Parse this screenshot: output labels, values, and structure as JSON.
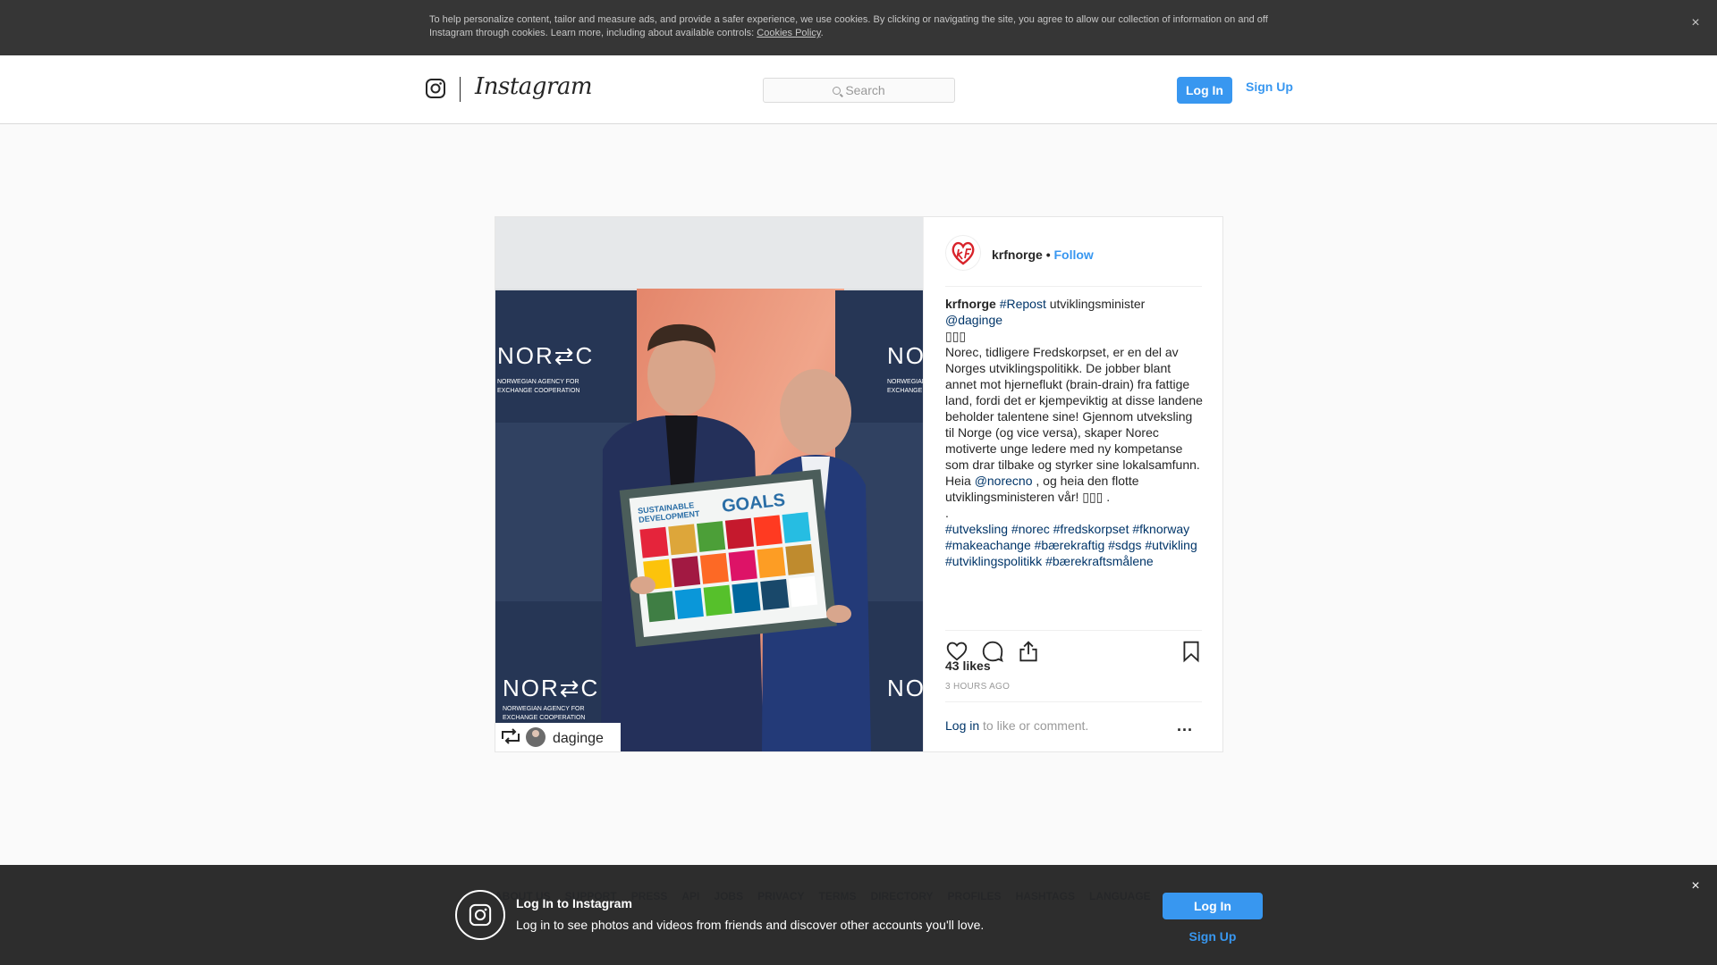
{
  "cookie_banner": {
    "text": "To help personalize content, tailor and measure ads, and provide a safer experience, we use cookies. By clicking or navigating the site, you agree to allow our collection of information on and off Instagram through cookies. Learn more, including about available controls: ",
    "link": "Cookies Policy",
    "close": "×"
  },
  "header": {
    "wordmark": "Instagram",
    "search_placeholder": "Search",
    "login": "Log In",
    "signup": "Sign Up"
  },
  "post": {
    "username": "krfnorge",
    "separator": "•",
    "follow": "Follow",
    "repost_user": "daginge",
    "caption": {
      "username": "krfnorge",
      "hashtag_repost": "#Repost",
      "text1": " utviklingsminister ",
      "mention1": "@daginge",
      "emoji1": "▯▯▯",
      "body": "Norec, tidligere Fredskorpset, er en del av Norges utviklingspolitikk. De jobber blant annet mot hjerneflukt (brain-drain) fra fattige land, fordi det er kjempeviktig at disse landene beholder talentene sine! Gjennom utveksling til Norge (og vice versa), skaper Norec motiverte unge ledere med ny kompetanse som drar tilbake og styrker sine lokalsamfunn. Heia ",
      "mention2": "@norecno",
      "body2": " , og heia den flotte utviklingsministeren vår! ▯▯▯  .",
      "dot": ".",
      "hashtags": [
        "#utveksling",
        "#norec",
        "#fredskorpset",
        "#fknorway",
        "#makeachange",
        "#bærekraftig",
        "#sdgs",
        "#utvikling",
        "#utviklingspolitikk",
        "#bærekraftsmålene"
      ]
    },
    "likes": "43 likes",
    "time": "3 HOURS AGO",
    "comment_login": "Log in",
    "comment_rest": " to like or comment.",
    "more": "..."
  },
  "photo_text": {
    "norec": "NOR⇄C",
    "agency_line1": "NORWEGIAN AGENCY FOR",
    "agency_line2": "EXCHANGE COOPERATION",
    "sdg_line1": "SUSTAINABLE",
    "sdg_line2": "DEVELOPMENT",
    "sdg_goals": "GOALS"
  },
  "footer_links": [
    "ABOUT US",
    "SUPPORT",
    "PRESS",
    "API",
    "JOBS",
    "PRIVACY",
    "TERMS",
    "DIRECTORY",
    "PROFILES",
    "HASHTAGS",
    "LANGUAGE"
  ],
  "bottom_bar": {
    "title": "Log In to Instagram",
    "description": "Log in to see photos and videos from friends and discover other accounts you'll love.",
    "login": "Log In",
    "signup": "Sign Up",
    "close": "×"
  },
  "colors": {
    "accent": "#3897f0",
    "link": "#003569",
    "cookie_bg": "#363636",
    "bottom_bg": "#262626"
  },
  "icons": [
    "close-icon",
    "instagram-glyph-icon",
    "search-icon",
    "heart-icon",
    "comment-icon",
    "share-icon",
    "bookmark-icon",
    "repost-icon"
  ]
}
